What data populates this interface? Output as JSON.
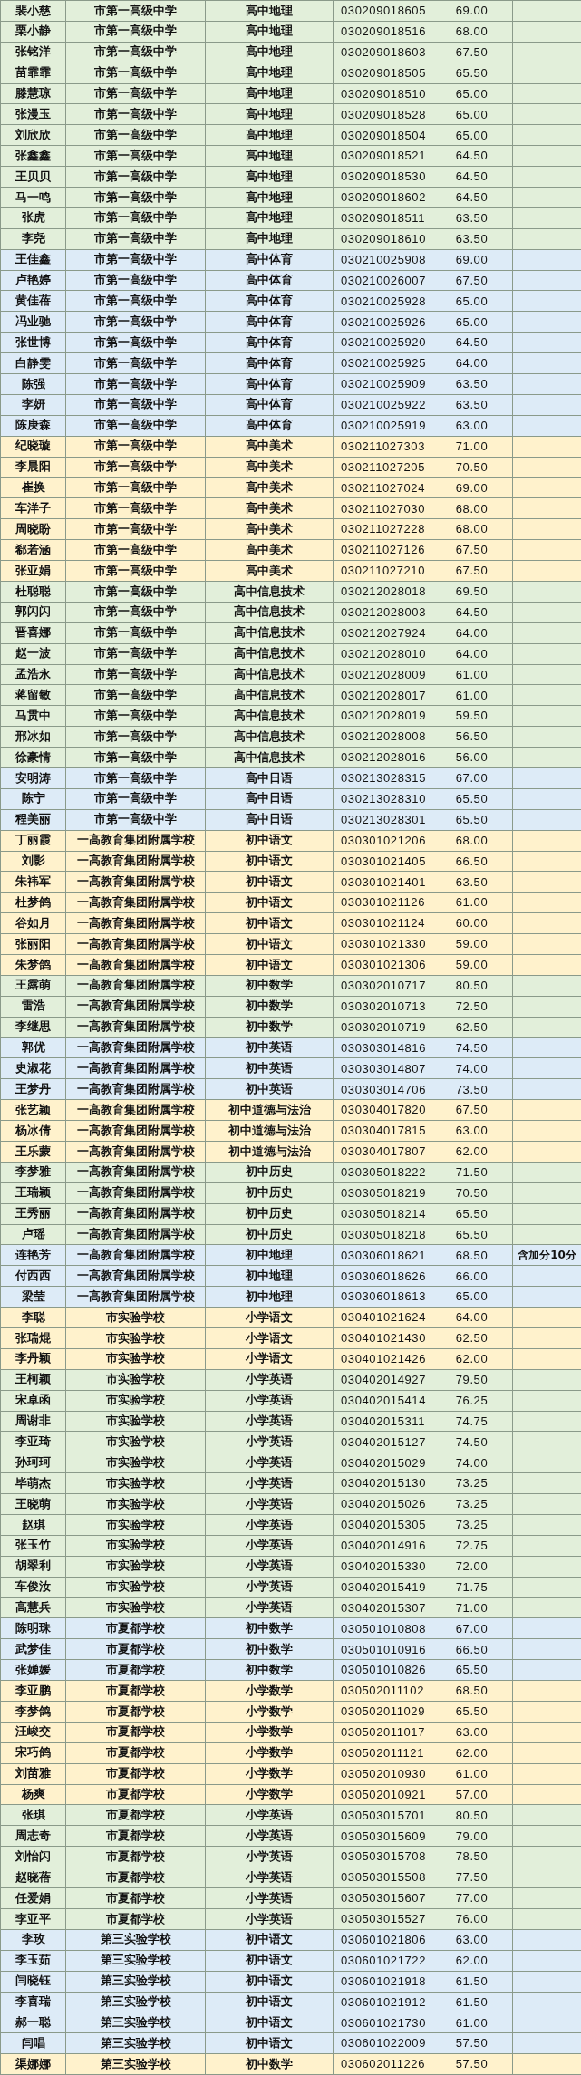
{
  "table": {
    "groups": [
      {
        "color": "#e2efda",
        "rows": [
          {
            "name": "裴小慈",
            "school": "市第一高级中学",
            "subject": "高中地理",
            "ticket": "030209018605",
            "score": "69.00"
          },
          {
            "name": "栗小静",
            "school": "市第一高级中学",
            "subject": "高中地理",
            "ticket": "030209018516",
            "score": "68.00"
          },
          {
            "name": "张铭洋",
            "school": "市第一高级中学",
            "subject": "高中地理",
            "ticket": "030209018603",
            "score": "67.50"
          },
          {
            "name": "苗霏霏",
            "school": "市第一高级中学",
            "subject": "高中地理",
            "ticket": "030209018505",
            "score": "65.50"
          },
          {
            "name": "滕慧琼",
            "school": "市第一高级中学",
            "subject": "高中地理",
            "ticket": "030209018510",
            "score": "65.00"
          },
          {
            "name": "张漫玉",
            "school": "市第一高级中学",
            "subject": "高中地理",
            "ticket": "030209018528",
            "score": "65.00"
          },
          {
            "name": "刘欣欣",
            "school": "市第一高级中学",
            "subject": "高中地理",
            "ticket": "030209018504",
            "score": "65.00"
          },
          {
            "name": "张鑫鑫",
            "school": "市第一高级中学",
            "subject": "高中地理",
            "ticket": "030209018521",
            "score": "64.50"
          },
          {
            "name": "王贝贝",
            "school": "市第一高级中学",
            "subject": "高中地理",
            "ticket": "030209018530",
            "score": "64.50"
          },
          {
            "name": "马一鸣",
            "school": "市第一高级中学",
            "subject": "高中地理",
            "ticket": "030209018602",
            "score": "64.50"
          },
          {
            "name": "张虎",
            "school": "市第一高级中学",
            "subject": "高中地理",
            "ticket": "030209018511",
            "score": "63.50"
          },
          {
            "name": "李尧",
            "school": "市第一高级中学",
            "subject": "高中地理",
            "ticket": "030209018610",
            "score": "63.50"
          }
        ]
      },
      {
        "color": "#ddebf7",
        "rows": [
          {
            "name": "王佳鑫",
            "school": "市第一高级中学",
            "subject": "高中体育",
            "ticket": "030210025908",
            "score": "69.00"
          },
          {
            "name": "卢艳婷",
            "school": "市第一高级中学",
            "subject": "高中体育",
            "ticket": "030210026007",
            "score": "67.50"
          },
          {
            "name": "黄佳蓓",
            "school": "市第一高级中学",
            "subject": "高中体育",
            "ticket": "030210025928",
            "score": "65.00"
          },
          {
            "name": "冯业驰",
            "school": "市第一高级中学",
            "subject": "高中体育",
            "ticket": "030210025926",
            "score": "65.00"
          },
          {
            "name": "张世博",
            "school": "市第一高级中学",
            "subject": "高中体育",
            "ticket": "030210025920",
            "score": "64.50"
          },
          {
            "name": "白静雯",
            "school": "市第一高级中学",
            "subject": "高中体育",
            "ticket": "030210025925",
            "score": "64.00"
          },
          {
            "name": "陈强",
            "school": "市第一高级中学",
            "subject": "高中体育",
            "ticket": "030210025909",
            "score": "63.50"
          },
          {
            "name": "李妍",
            "school": "市第一高级中学",
            "subject": "高中体育",
            "ticket": "030210025922",
            "score": "63.50"
          },
          {
            "name": "陈庚森",
            "school": "市第一高级中学",
            "subject": "高中体育",
            "ticket": "030210025919",
            "score": "63.00"
          }
        ]
      },
      {
        "color": "#fff2cc",
        "rows": [
          {
            "name": "纪晓璇",
            "school": "市第一高级中学",
            "subject": "高中美术",
            "ticket": "030211027303",
            "score": "71.00"
          },
          {
            "name": "李晨阳",
            "school": "市第一高级中学",
            "subject": "高中美术",
            "ticket": "030211027205",
            "score": "70.50"
          },
          {
            "name": "崔换",
            "school": "市第一高级中学",
            "subject": "高中美术",
            "ticket": "030211027024",
            "score": "69.00"
          },
          {
            "name": "车洋子",
            "school": "市第一高级中学",
            "subject": "高中美术",
            "ticket": "030211027030",
            "score": "68.00"
          },
          {
            "name": "周晓盼",
            "school": "市第一高级中学",
            "subject": "高中美术",
            "ticket": "030211027228",
            "score": "68.00"
          },
          {
            "name": "郗若涵",
            "school": "市第一高级中学",
            "subject": "高中美术",
            "ticket": "030211027126",
            "score": "67.50"
          },
          {
            "name": "张亚娟",
            "school": "市第一高级中学",
            "subject": "高中美术",
            "ticket": "030211027210",
            "score": "67.50"
          }
        ]
      },
      {
        "color": "#e2efda",
        "rows": [
          {
            "name": "杜聪聪",
            "school": "市第一高级中学",
            "subject": "高中信息技术",
            "ticket": "030212028018",
            "score": "69.50"
          },
          {
            "name": "郭闪闪",
            "school": "市第一高级中学",
            "subject": "高中信息技术",
            "ticket": "030212028003",
            "score": "64.50"
          },
          {
            "name": "晋喜娜",
            "school": "市第一高级中学",
            "subject": "高中信息技术",
            "ticket": "030212027924",
            "score": "64.00"
          },
          {
            "name": "赵一波",
            "school": "市第一高级中学",
            "subject": "高中信息技术",
            "ticket": "030212028010",
            "score": "64.00"
          },
          {
            "name": "孟浩永",
            "school": "市第一高级中学",
            "subject": "高中信息技术",
            "ticket": "030212028009",
            "score": "61.00"
          },
          {
            "name": "蒋留敏",
            "school": "市第一高级中学",
            "subject": "高中信息技术",
            "ticket": "030212028017",
            "score": "61.00"
          },
          {
            "name": "马贯中",
            "school": "市第一高级中学",
            "subject": "高中信息技术",
            "ticket": "030212028019",
            "score": "59.50"
          },
          {
            "name": "邢冰如",
            "school": "市第一高级中学",
            "subject": "高中信息技术",
            "ticket": "030212028008",
            "score": "56.50"
          },
          {
            "name": "徐豪情",
            "school": "市第一高级中学",
            "subject": "高中信息技术",
            "ticket": "030212028016",
            "score": "56.00"
          }
        ]
      },
      {
        "color": "#ddebf7",
        "rows": [
          {
            "name": "安明涛",
            "school": "市第一高级中学",
            "subject": "高中日语",
            "ticket": "030213028315",
            "score": "67.00"
          },
          {
            "name": "陈宁",
            "school": "市第一高级中学",
            "subject": "高中日语",
            "ticket": "030213028310",
            "score": "65.50"
          },
          {
            "name": "程美丽",
            "school": "市第一高级中学",
            "subject": "高中日语",
            "ticket": "030213028301",
            "score": "65.50"
          }
        ]
      },
      {
        "color": "#fff2cc",
        "rows": [
          {
            "name": "丁丽霞",
            "school": "一高教育集团附属学校",
            "subject": "初中语文",
            "ticket": "030301021206",
            "score": "68.00"
          },
          {
            "name": "刘影",
            "school": "一高教育集团附属学校",
            "subject": "初中语文",
            "ticket": "030301021405",
            "score": "66.50"
          },
          {
            "name": "朱祎军",
            "school": "一高教育集团附属学校",
            "subject": "初中语文",
            "ticket": "030301021401",
            "score": "63.50"
          },
          {
            "name": "杜梦鸽",
            "school": "一高教育集团附属学校",
            "subject": "初中语文",
            "ticket": "030301021126",
            "score": "61.00"
          },
          {
            "name": "谷如月",
            "school": "一高教育集团附属学校",
            "subject": "初中语文",
            "ticket": "030301021124",
            "score": "60.00"
          },
          {
            "name": "张丽阳",
            "school": "一高教育集团附属学校",
            "subject": "初中语文",
            "ticket": "030301021330",
            "score": "59.00"
          },
          {
            "name": "朱梦鸽",
            "school": "一高教育集团附属学校",
            "subject": "初中语文",
            "ticket": "030301021306",
            "score": "59.00"
          }
        ]
      },
      {
        "color": "#e2efda",
        "rows": [
          {
            "name": "王露萌",
            "school": "一高教育集团附属学校",
            "subject": "初中数学",
            "ticket": "030302010717",
            "score": "80.50"
          },
          {
            "name": "雷浩",
            "school": "一高教育集团附属学校",
            "subject": "初中数学",
            "ticket": "030302010713",
            "score": "72.50"
          },
          {
            "name": "李继思",
            "school": "一高教育集团附属学校",
            "subject": "初中数学",
            "ticket": "030302010719",
            "score": "62.50"
          }
        ]
      },
      {
        "color": "#ddebf7",
        "rows": [
          {
            "name": "郭优",
            "school": "一高教育集团附属学校",
            "subject": "初中英语",
            "ticket": "030303014816",
            "score": "74.50"
          },
          {
            "name": "史淑花",
            "school": "一高教育集团附属学校",
            "subject": "初中英语",
            "ticket": "030303014807",
            "score": "74.00"
          },
          {
            "name": "王梦丹",
            "school": "一高教育集团附属学校",
            "subject": "初中英语",
            "ticket": "030303014706",
            "score": "73.50"
          }
        ]
      },
      {
        "color": "#fff2cc",
        "rows": [
          {
            "name": "张艺颖",
            "school": "一高教育集团附属学校",
            "subject": "初中道德与法治",
            "ticket": "030304017820",
            "score": "67.50"
          },
          {
            "name": "杨冰倩",
            "school": "一高教育集团附属学校",
            "subject": "初中道德与法治",
            "ticket": "030304017815",
            "score": "63.00"
          },
          {
            "name": "王乐蒙",
            "school": "一高教育集团附属学校",
            "subject": "初中道德与法治",
            "ticket": "030304017807",
            "score": "62.00"
          }
        ]
      },
      {
        "color": "#e2efda",
        "rows": [
          {
            "name": "李梦雅",
            "school": "一高教育集团附属学校",
            "subject": "初中历史",
            "ticket": "030305018222",
            "score": "71.50"
          },
          {
            "name": "王瑞颖",
            "school": "一高教育集团附属学校",
            "subject": "初中历史",
            "ticket": "030305018219",
            "score": "70.50"
          },
          {
            "name": "王秀丽",
            "school": "一高教育集团附属学校",
            "subject": "初中历史",
            "ticket": "030305018214",
            "score": "65.50"
          },
          {
            "name": "卢瑶",
            "school": "一高教育集团附属学校",
            "subject": "初中历史",
            "ticket": "030305018218",
            "score": "65.50"
          }
        ]
      },
      {
        "color": "#ddebf7",
        "rows": [
          {
            "name": "连艳芳",
            "school": "一高教育集团附属学校",
            "subject": "初中地理",
            "ticket": "030306018621",
            "score": "68.50",
            "note": "含加分10分"
          },
          {
            "name": "付西西",
            "school": "一高教育集团附属学校",
            "subject": "初中地理",
            "ticket": "030306018626",
            "score": "66.00"
          },
          {
            "name": "梁莹",
            "school": "一高教育集团附属学校",
            "subject": "初中地理",
            "ticket": "030306018613",
            "score": "65.00"
          }
        ]
      },
      {
        "color": "#fff2cc",
        "rows": [
          {
            "name": "李聪",
            "school": "市实验学校",
            "subject": "小学语文",
            "ticket": "030401021624",
            "score": "64.00"
          },
          {
            "name": "张瑞焜",
            "school": "市实验学校",
            "subject": "小学语文",
            "ticket": "030401021430",
            "score": "62.50"
          },
          {
            "name": "李丹颖",
            "school": "市实验学校",
            "subject": "小学语文",
            "ticket": "030401021426",
            "score": "62.00"
          }
        ]
      },
      {
        "color": "#e2efda",
        "rows": [
          {
            "name": "王柯颖",
            "school": "市实验学校",
            "subject": "小学英语",
            "ticket": "030402014927",
            "score": "79.50"
          },
          {
            "name": "宋卓函",
            "school": "市实验学校",
            "subject": "小学英语",
            "ticket": "030402015414",
            "score": "76.25"
          },
          {
            "name": "周谢非",
            "school": "市实验学校",
            "subject": "小学英语",
            "ticket": "030402015311",
            "score": "74.75"
          },
          {
            "name": "李亚琦",
            "school": "市实验学校",
            "subject": "小学英语",
            "ticket": "030402015127",
            "score": "74.50"
          },
          {
            "name": "孙珂珂",
            "school": "市实验学校",
            "subject": "小学英语",
            "ticket": "030402015029",
            "score": "74.00"
          },
          {
            "name": "毕萌杰",
            "school": "市实验学校",
            "subject": "小学英语",
            "ticket": "030402015130",
            "score": "73.25"
          },
          {
            "name": "王晓萌",
            "school": "市实验学校",
            "subject": "小学英语",
            "ticket": "030402015026",
            "score": "73.25"
          },
          {
            "name": "赵琪",
            "school": "市实验学校",
            "subject": "小学英语",
            "ticket": "030402015305",
            "score": "73.25"
          },
          {
            "name": "张玉竹",
            "school": "市实验学校",
            "subject": "小学英语",
            "ticket": "030402014916",
            "score": "72.75"
          },
          {
            "name": "胡翠利",
            "school": "市实验学校",
            "subject": "小学英语",
            "ticket": "030402015330",
            "score": "72.00"
          },
          {
            "name": "车俊汝",
            "school": "市实验学校",
            "subject": "小学英语",
            "ticket": "030402015419",
            "score": "71.75"
          },
          {
            "name": "高慧兵",
            "school": "市实验学校",
            "subject": "小学英语",
            "ticket": "030402015307",
            "score": "71.00"
          }
        ]
      },
      {
        "color": "#ddebf7",
        "rows": [
          {
            "name": "陈明珠",
            "school": "市夏都学校",
            "subject": "初中数学",
            "ticket": "030501010808",
            "score": "67.00"
          },
          {
            "name": "武梦佳",
            "school": "市夏都学校",
            "subject": "初中数学",
            "ticket": "030501010916",
            "score": "66.50"
          },
          {
            "name": "张婵媛",
            "school": "市夏都学校",
            "subject": "初中数学",
            "ticket": "030501010826",
            "score": "65.50"
          }
        ]
      },
      {
        "color": "#fff2cc",
        "rows": [
          {
            "name": "李亚鹏",
            "school": "市夏都学校",
            "subject": "小学数学",
            "ticket": "030502011102",
            "score": "68.50"
          },
          {
            "name": "李梦鸽",
            "school": "市夏都学校",
            "subject": "小学数学",
            "ticket": "030502011029",
            "score": "65.50"
          },
          {
            "name": "汪峻交",
            "school": "市夏都学校",
            "subject": "小学数学",
            "ticket": "030502011017",
            "score": "63.00"
          },
          {
            "name": "宋巧鸽",
            "school": "市夏都学校",
            "subject": "小学数学",
            "ticket": "030502011121",
            "score": "62.00"
          },
          {
            "name": "刘苗雅",
            "school": "市夏都学校",
            "subject": "小学数学",
            "ticket": "030502010930",
            "score": "61.00"
          },
          {
            "name": "杨爽",
            "school": "市夏都学校",
            "subject": "小学数学",
            "ticket": "030502010921",
            "score": "57.00"
          }
        ]
      },
      {
        "color": "#e2efda",
        "rows": [
          {
            "name": "张琪",
            "school": "市夏都学校",
            "subject": "小学英语",
            "ticket": "030503015701",
            "score": "80.50"
          },
          {
            "name": "周志奇",
            "school": "市夏都学校",
            "subject": "小学英语",
            "ticket": "030503015609",
            "score": "79.00"
          },
          {
            "name": "刘怡闪",
            "school": "市夏都学校",
            "subject": "小学英语",
            "ticket": "030503015708",
            "score": "78.50"
          },
          {
            "name": "赵晓蓓",
            "school": "市夏都学校",
            "subject": "小学英语",
            "ticket": "030503015508",
            "score": "77.50"
          },
          {
            "name": "任爱娟",
            "school": "市夏都学校",
            "subject": "小学英语",
            "ticket": "030503015607",
            "score": "77.00"
          },
          {
            "name": "李亚平",
            "school": "市夏都学校",
            "subject": "小学英语",
            "ticket": "030503015527",
            "score": "76.00"
          }
        ]
      },
      {
        "color": "#ddebf7",
        "rows": [
          {
            "name": "李玫",
            "school": "第三实验学校",
            "subject": "初中语文",
            "ticket": "030601021806",
            "score": "63.00"
          },
          {
            "name": "李玉茹",
            "school": "第三实验学校",
            "subject": "初中语文",
            "ticket": "030601021722",
            "score": "62.00"
          },
          {
            "name": "闫晓钰",
            "school": "第三实验学校",
            "subject": "初中语文",
            "ticket": "030601021918",
            "score": "61.50"
          },
          {
            "name": "李喜瑞",
            "school": "第三实验学校",
            "subject": "初中语文",
            "ticket": "030601021912",
            "score": "61.50"
          },
          {
            "name": "郝一聪",
            "school": "第三实验学校",
            "subject": "初中语文",
            "ticket": "030601021730",
            "score": "61.00"
          },
          {
            "name": "闫唱",
            "school": "第三实验学校",
            "subject": "初中语文",
            "ticket": "030601022009",
            "score": "57.50"
          }
        ]
      },
      {
        "color": "#fff2cc",
        "rows": [
          {
            "name": "渠娜娜",
            "school": "第三实验学校",
            "subject": "初中数学",
            "ticket": "030602011226",
            "score": "57.50"
          }
        ]
      }
    ]
  }
}
